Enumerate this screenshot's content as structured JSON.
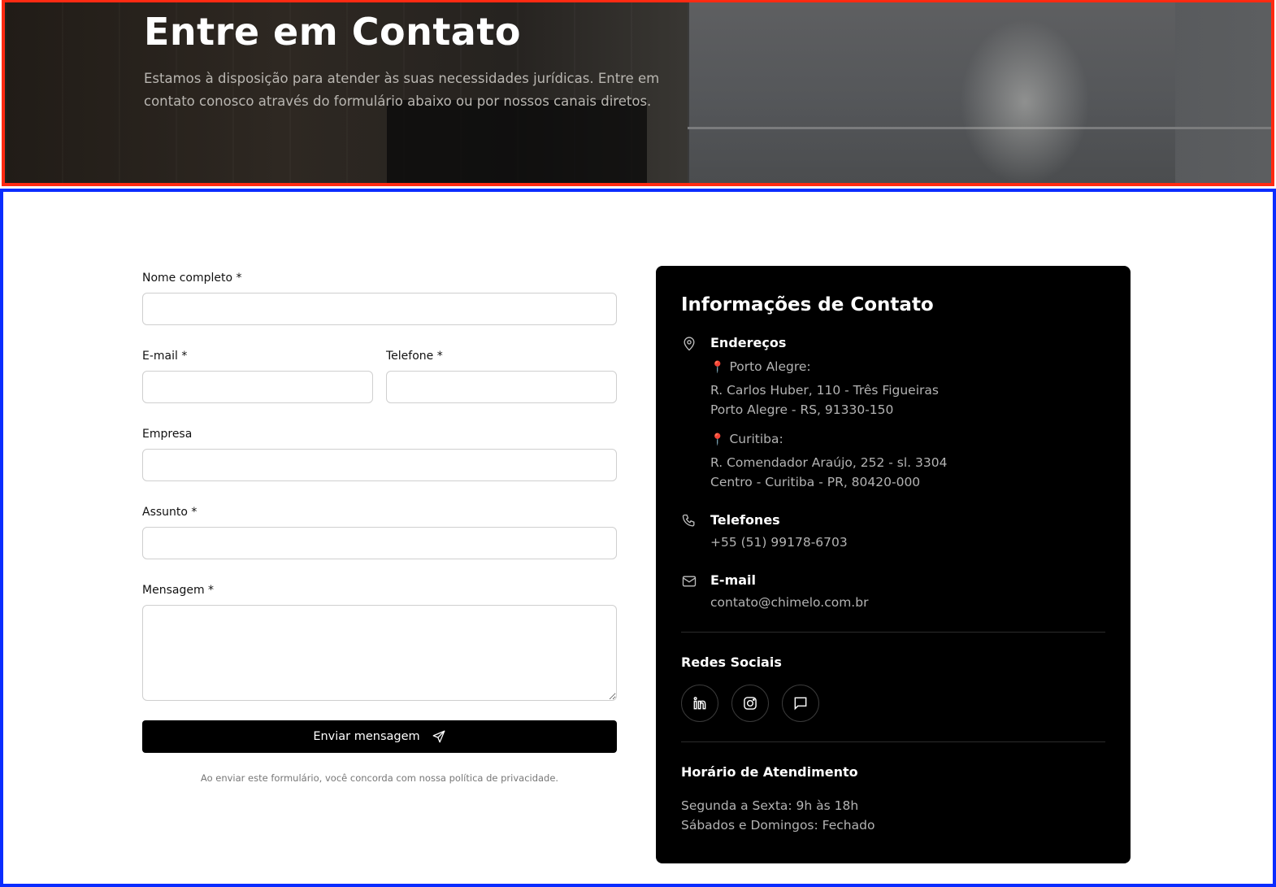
{
  "hero": {
    "title": "Entre em Contato",
    "subtitle": "Estamos à disposição para atender às suas necessidades jurídicas. Entre em contato conosco através do formulário abaixo ou por nossos canais diretos."
  },
  "form": {
    "name_label": "Nome completo *",
    "name_value": "",
    "email_label": "E-mail *",
    "email_value": "",
    "phone_label": "Telefone *",
    "phone_value": "",
    "company_label": "Empresa",
    "company_value": "",
    "subject_label": "Assunto *",
    "subject_value": "",
    "message_label": "Mensagem *",
    "message_value": "",
    "submit_label": "Enviar mensagem",
    "privacy_note": "Ao enviar este formulário, você concorda com nossa política de privacidade."
  },
  "contact_info": {
    "title": "Informações de Contato",
    "addresses": {
      "title": "Endereços",
      "pin_glyph": "📍",
      "offices": [
        {
          "city": "Porto Alegre:",
          "line1": "R. Carlos Huber, 110 - Três Figueiras",
          "line2": "Porto Alegre - RS, 91330-150"
        },
        {
          "city": "Curitiba:",
          "line1": "R. Comendador Araújo, 252 - sl. 3304",
          "line2": "Centro - Curitiba - PR, 80420-000"
        }
      ]
    },
    "phones": {
      "title": "Telefones",
      "value": "+55 (51) 99178-6703"
    },
    "email": {
      "title": "E-mail",
      "value": "contato@chimelo.com.br"
    },
    "social": {
      "title": "Redes Sociais",
      "icons": [
        "linkedin-icon",
        "instagram-icon",
        "message-icon"
      ]
    },
    "hours": {
      "title": "Horário de Atendimento",
      "weekdays": "Segunda a Sexta: 9h às 18h",
      "weekend": "Sábados e Domingos: Fechado"
    }
  },
  "colors": {
    "hero_border": "#ff2a12",
    "main_border": "#0a2cff",
    "card_bg": "#000000",
    "button_bg": "#000000"
  }
}
